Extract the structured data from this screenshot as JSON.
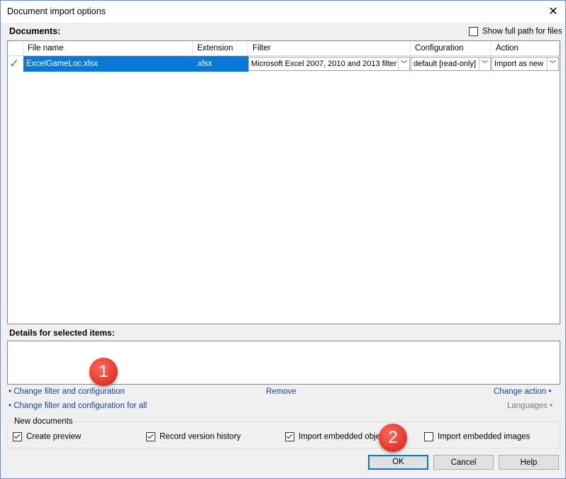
{
  "window": {
    "title": "Document import options",
    "close_glyph": "✕"
  },
  "documents": {
    "label": "Documents:",
    "show_full_path_label": "Show full path for files",
    "show_full_path_checked": false,
    "columns": [
      "File name",
      "Extension",
      "Filter",
      "Configuration",
      "Action"
    ],
    "rows": [
      {
        "status_icon": "green-check-icon",
        "file_name": "ExcelGameLoc.xlsx",
        "extension": ".xlsx",
        "filter": "Microsoft Excel 2007, 2010 and 2013 filter",
        "configuration": "default [read-only]",
        "action": "Import as new"
      }
    ]
  },
  "details": {
    "label": "Details for selected items:",
    "links": {
      "change_filter": "• Change filter and configuration",
      "remove": "Remove",
      "change_action": "Change action •",
      "change_filter_all": "• Change filter and configuration for all",
      "languages": "Languages •"
    }
  },
  "new_documents": {
    "legend": "New documents",
    "options": [
      {
        "label": "Create preview",
        "checked": true
      },
      {
        "label": "Record version history",
        "checked": true
      },
      {
        "label": "Import embedded objects",
        "checked": true
      },
      {
        "label": "Import embedded images",
        "checked": false
      }
    ]
  },
  "buttons": {
    "ok": "OK",
    "cancel": "Cancel",
    "help": "Help"
  },
  "annotations": {
    "badge1": "1",
    "badge2": "2",
    "badge_color": "#e63b2e"
  },
  "colors": {
    "selection": "#0a78d7",
    "link": "#1a3db8",
    "check": "#2aa12a"
  }
}
